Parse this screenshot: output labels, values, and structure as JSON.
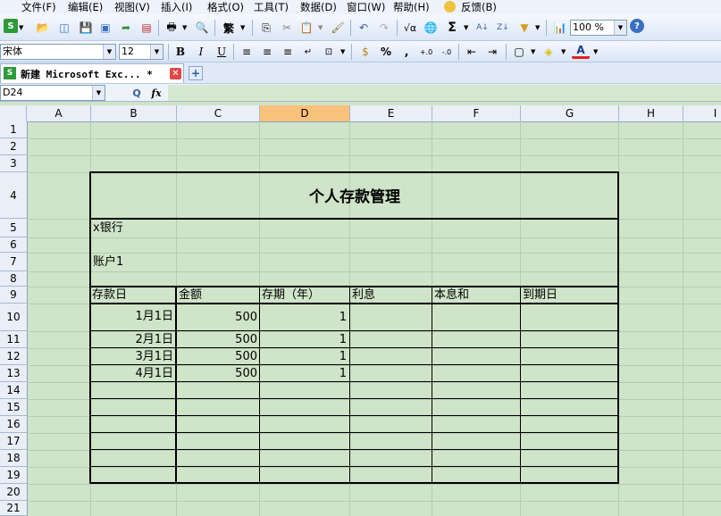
{
  "menu": [
    "文件(F)",
    "编辑(E)",
    "视图(V)",
    "插入(I)",
    "格式(O)",
    "工具(T)",
    "数据(D)",
    "窗口(W)",
    "帮助(H)",
    "反馈(B)"
  ],
  "toolbar": {
    "zoom": "100 %",
    "font_name": "宋体",
    "font_size": "12"
  },
  "tab": {
    "title": "新建 Microsoft Exc... *"
  },
  "formula_bar": {
    "name_box": "D24",
    "search_icon": "Q",
    "fx_label": "fx"
  },
  "columns": [
    "A",
    "B",
    "C",
    "D",
    "E",
    "F",
    "G",
    "H",
    "I"
  ],
  "rows": [
    "1",
    "2",
    "3",
    "4",
    "5",
    "6",
    "7",
    "8",
    "9",
    "10",
    "11",
    "12",
    "13",
    "14",
    "15",
    "16",
    "17",
    "18",
    "19",
    "20",
    "21"
  ],
  "sheet": {
    "title": "个人存款管理",
    "bank": "x银行",
    "account": "账户1",
    "headers": [
      "存款日",
      "金额",
      "存期（年）",
      "利息",
      "本息和",
      "到期日"
    ],
    "records": [
      [
        "1月1日",
        "500",
        "1"
      ],
      [
        "2月1日",
        "500",
        "1"
      ],
      [
        "3月1日",
        "500",
        "1"
      ],
      [
        "4月1日",
        "500",
        "1"
      ]
    ]
  }
}
